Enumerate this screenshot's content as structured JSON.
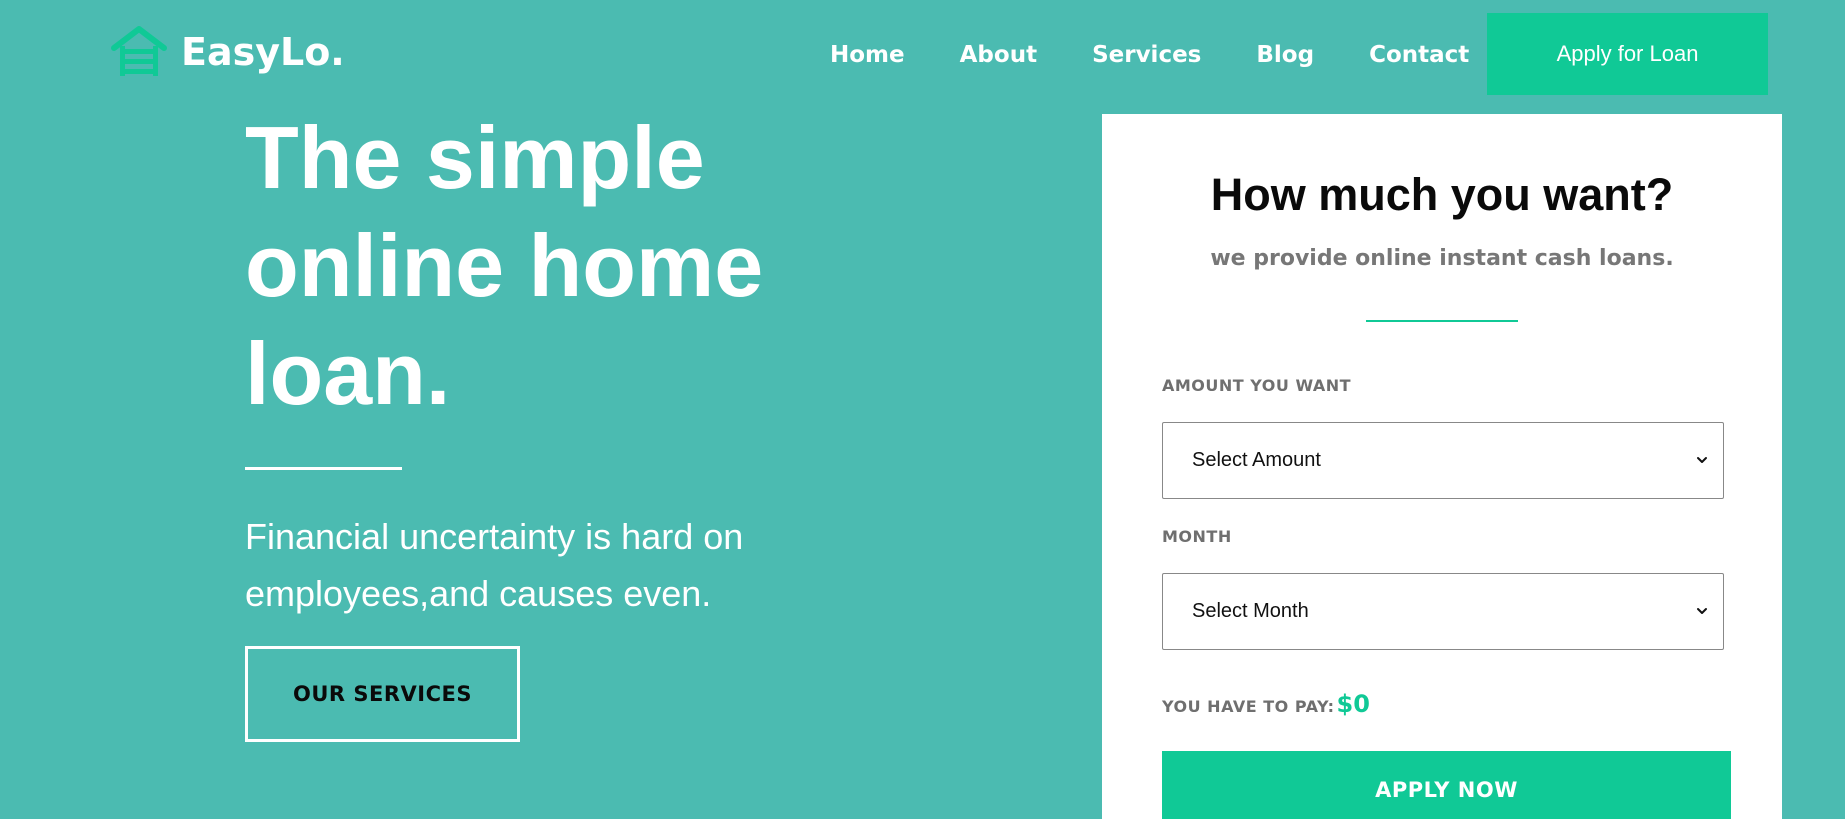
{
  "brand": {
    "name": "EasyLo.",
    "icon": "house-stack-icon",
    "accent_color": "#10c996",
    "background_color": "#4bbbb1"
  },
  "nav": {
    "items": [
      "Home",
      "About",
      "Services",
      "Blog",
      "Contact"
    ],
    "cta_label": "Apply for Loan"
  },
  "hero": {
    "title": "The simple online home loan.",
    "subtitle": "Financial uncertainty is hard on employees,and causes even.",
    "button_label": "OUR SERVICES"
  },
  "loan_form": {
    "title": "How much you want?",
    "subtitle": "we provide online instant cash loans.",
    "amount_label": "AMOUNT YOU WANT",
    "amount_selected": "Select Amount",
    "month_label": "MONTH",
    "month_selected": "Select Month",
    "pay_label": "YOU HAVE TO PAY:",
    "pay_value": "$0",
    "submit_label": "APPLY NOW"
  }
}
